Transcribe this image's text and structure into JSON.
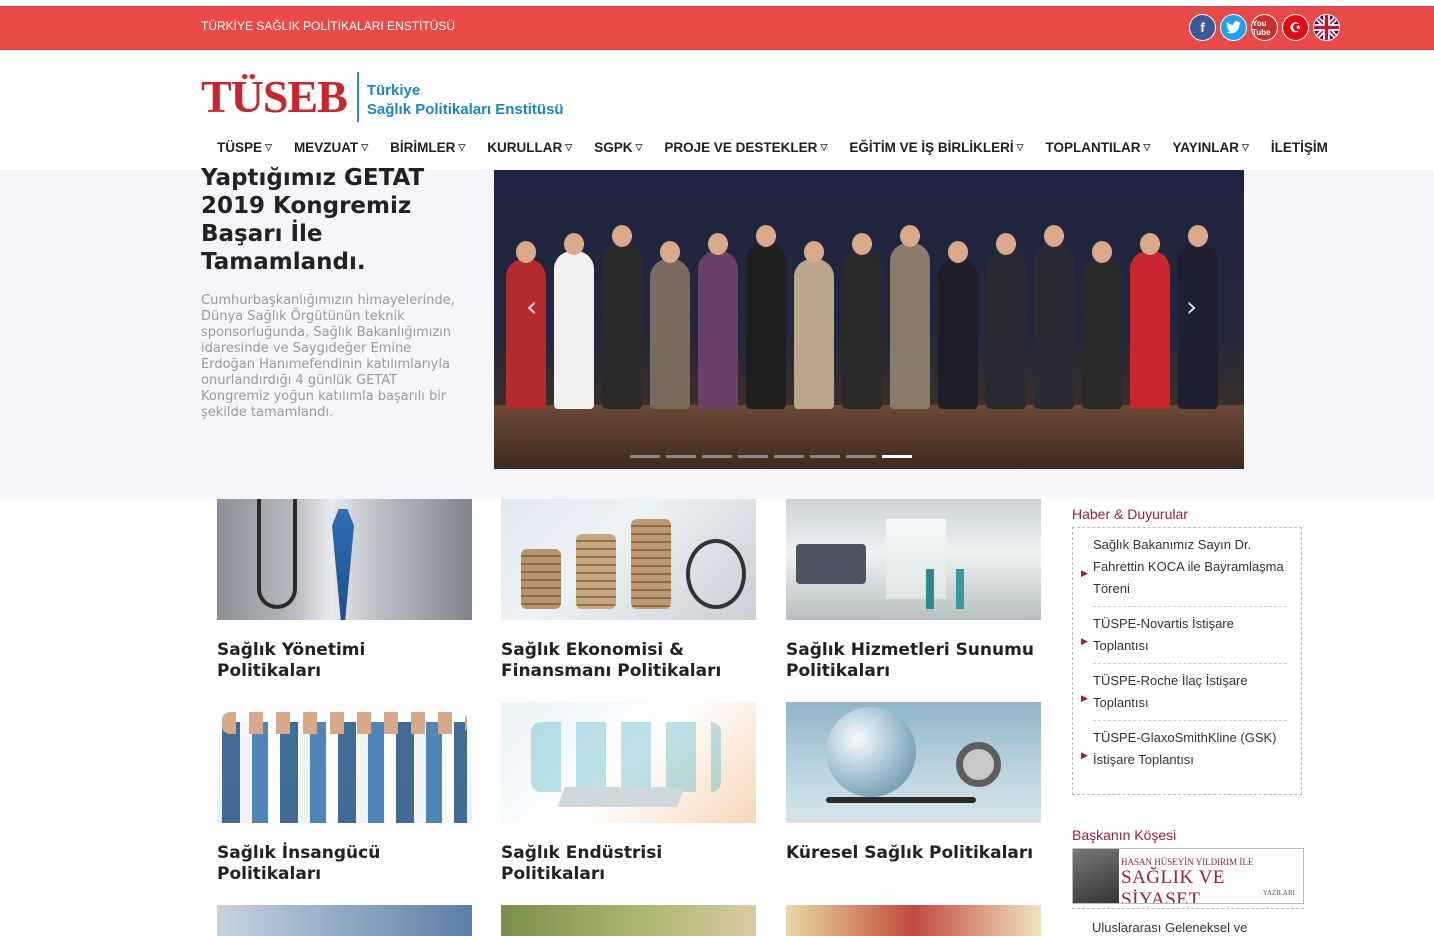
{
  "topbar": {
    "institute_name": "TÜRKİYE SAĞLIK POLİTİKALARI ENSTİTÜSÜ",
    "social": [
      {
        "icon": "facebook-icon",
        "glyph": "f"
      },
      {
        "icon": "twitter-icon",
        "glyph": "t"
      },
      {
        "icon": "youtube-icon",
        "glyph": "You Tube"
      },
      {
        "icon": "turkish-flag-icon",
        "glyph": "☪"
      },
      {
        "icon": "uk-flag-icon",
        "glyph": ""
      }
    ],
    "color": "#e84a47"
  },
  "header": {
    "logo_mark": "TÜSEB",
    "logo_line1": "Türkiye",
    "logo_line2": "Sağlık Politikaları Enstitüsü"
  },
  "nav": {
    "items": [
      {
        "label": "TÜSPE",
        "dropdown": true
      },
      {
        "label": "MEVZUAT",
        "dropdown": true
      },
      {
        "label": "BİRİMLER",
        "dropdown": true
      },
      {
        "label": "KURULLAR",
        "dropdown": true
      },
      {
        "label": "SGPK",
        "dropdown": true
      },
      {
        "label": "PROJE VE DESTEKLER",
        "dropdown": true
      },
      {
        "label": "EĞİTİM VE İŞ BİRLİKLERİ",
        "dropdown": true
      },
      {
        "label": "TOPLANTILAR",
        "dropdown": true
      },
      {
        "label": "YAYINLAR",
        "dropdown": true
      },
      {
        "label": "İLETİŞİM",
        "dropdown": false
      }
    ]
  },
  "hero": {
    "title": "Yaptığımız GETAT 2019 Kongremiz Başarı İle Tamamlandı.",
    "description": "Cumhurbaşkanlığımızın himayelerinde, Dünya Sağlık Örgütünün teknik sponsorluğunda, Sağlık Bakanlığımızın idaresinde ve Saygıdeğer Emine Erdoğan Hanımefendinin katılımlarıyla onurlandırdığı 4 günlük GETAT Kongremiz yoğun katılımla başarılı bir şekilde tamamlandı.",
    "slide_count": 8,
    "active_slide": 8
  },
  "cards": [
    {
      "title": "Sağlık Yönetimi Politikaları"
    },
    {
      "title": "Sağlık Ekonomisi & Finansmanı Politikaları"
    },
    {
      "title": "Sağlık Hizmetleri Sunumu Politikaları"
    },
    {
      "title": "Sağlık İnsangücü Politikaları"
    },
    {
      "title": "Sağlık Endüstrisi Politikaları"
    },
    {
      "title": "Küresel Sağlık Politikaları"
    }
  ],
  "sidebar": {
    "news_heading": "Haber & Duyurular",
    "news": [
      "Sağlık Bakanımız Sayın Dr. Fahrettin KOCA ile Bayramlaşma Töreni",
      "TÜSPE-Novartis İstişare Toplantısı",
      "TÜSPE-Roche İlaç İstişare Toplantısı",
      "TÜSPE-GlaxoSmithKline (GSK) İstişare Toplantısı"
    ],
    "president_heading": "Başkanın Köşesi",
    "banner_small": "HASAN HÜSEYİN YILDIRIM İLE",
    "banner_big": "SAĞLIK VE SİYASET",
    "banner_tiny": "YAZILARI",
    "next_item": "Uluslararası Geleneksel ve"
  }
}
